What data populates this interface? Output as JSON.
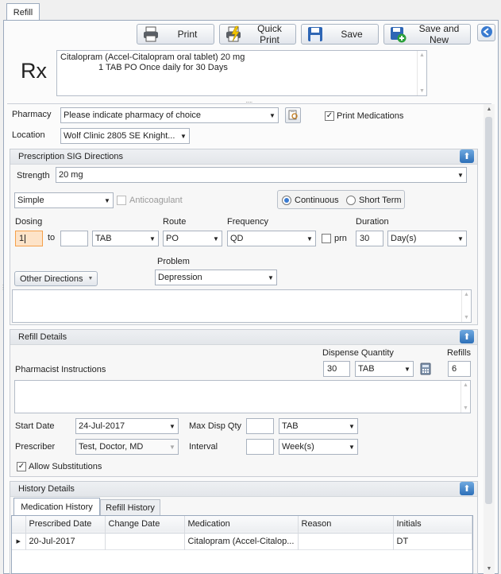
{
  "window": {
    "tab_label": "Refill"
  },
  "toolbar": {
    "print_label": "Print",
    "quick_print_label": "Quick Print",
    "save_label": "Save",
    "save_new_label": "Save and New"
  },
  "rx": {
    "symbol": "Rx",
    "summary_line1": "Citalopram (Accel-Citalopram oral tablet) 20 mg",
    "summary_line2": "1 TAB PO Once daily for 30 Days"
  },
  "pharmacy": {
    "label": "Pharmacy",
    "value": "Please indicate pharmacy of choice",
    "print_medications_label": "Print Medications",
    "print_medications_checked": true
  },
  "location": {
    "label": "Location",
    "value": "Wolf Clinic 2805 SE Knight..."
  },
  "sig": {
    "section_title": "Prescription SIG Directions",
    "strength_label": "Strength",
    "strength_value": "20 mg",
    "type_value": "Simple",
    "anticoagulant_label": "Anticoagulant",
    "continuous_label": "Continuous",
    "short_term_label": "Short Term",
    "dosing_label": "Dosing",
    "dosing_from": "1",
    "to_label": "to",
    "dosing_to": "",
    "unit_value": "TAB",
    "route_label": "Route",
    "route_value": "PO",
    "frequency_label": "Frequency",
    "frequency_value": "QD",
    "prn_label": "prn",
    "duration_label": "Duration",
    "duration_value": "30",
    "duration_unit": "Day(s)",
    "problem_label": "Problem",
    "problem_value": "Depression",
    "other_directions_label": "Other Directions"
  },
  "refill": {
    "section_title": "Refill Details",
    "dispense_quantity_label": "Dispense Quantity",
    "dispense_quantity_value": "30",
    "dispense_unit": "TAB",
    "refills_label": "Refills",
    "refills_value": "6",
    "pharmacist_instructions_label": "Pharmacist Instructions",
    "start_date_label": "Start Date",
    "start_date_value": "24-Jul-2017",
    "max_disp_label": "Max Disp Qty",
    "max_disp_value": "",
    "max_disp_unit": "TAB",
    "prescriber_label": "Prescriber",
    "prescriber_value": "Test, Doctor, MD",
    "interval_label": "Interval",
    "interval_value": "",
    "interval_unit": "Week(s)",
    "allow_substitutions_label": "Allow Substitutions",
    "allow_substitutions_checked": true
  },
  "history": {
    "section_title": "History Details",
    "tabs": [
      {
        "label": "Medication History"
      },
      {
        "label": "Refill History"
      }
    ],
    "columns": [
      "Prescribed Date",
      "Change Date",
      "Medication",
      "Reason",
      "Initials"
    ],
    "rows": [
      {
        "prescribed_date": "20-Jul-2017",
        "change_date": "",
        "medication": "Citalopram (Accel-Citalop...",
        "reason": "",
        "initials": "DT"
      }
    ]
  },
  "colors": {
    "accent_blue": "#2d6fb8",
    "focus_orange": "#f5a04a"
  }
}
